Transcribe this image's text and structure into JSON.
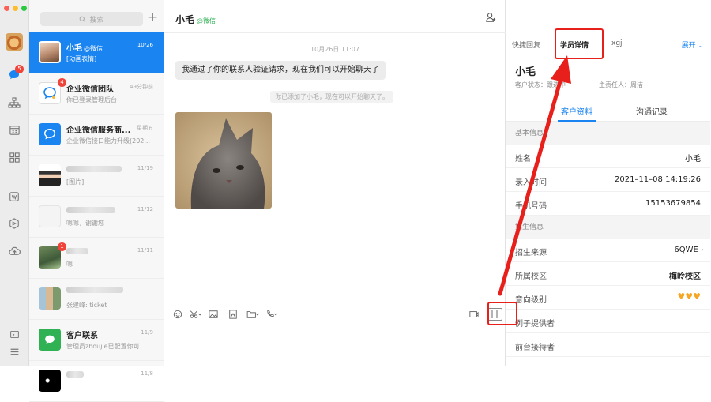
{
  "sidebar": {
    "badge": "5",
    "icons": [
      "avatar",
      "chat-icon",
      "org-icon",
      "calendar-icon",
      "apps-icon",
      "doc-icon",
      "drive-icon",
      "cloud-icon",
      "terminal-icon",
      "menu-icon"
    ]
  },
  "list": {
    "search_placeholder": "搜索",
    "items": [
      {
        "name": "小毛",
        "tag": "@微信",
        "time": "10/26",
        "preview": "[动画表情]"
      },
      {
        "name": "企业微信团队",
        "time": "49分钟前",
        "preview": "你已登录管理后台",
        "badge": "4"
      },
      {
        "name": "企业微信服务商...",
        "time": "星期五",
        "preview": "企业微信接口能力升级(202..."
      },
      {
        "name": "",
        "time": "11/19",
        "preview": "[图片]"
      },
      {
        "name": "",
        "time": "11/12",
        "preview": "嗯嗯，谢谢您"
      },
      {
        "name": "",
        "time": "11/11",
        "preview": "嗯",
        "badge": "1"
      },
      {
        "name": "",
        "time": "",
        "preview": "张建峰: ticket"
      },
      {
        "name": "客户联系",
        "time": "11/9",
        "preview": "管理员zhoujie已配置你可..."
      },
      {
        "name": "",
        "time": "11/8",
        "preview": ""
      }
    ]
  },
  "chat": {
    "title": "小毛",
    "tag": "@微信",
    "timestamp": "10月26日 11:07",
    "message": "我通过了你的联系人验证请求，现在我们可以开始聊天了",
    "system_message": "你已添加了小毛，现在可以开始聊天了。"
  },
  "panel": {
    "tabs": [
      "快捷回复",
      "学员详情",
      "xgj"
    ],
    "expand": "展开",
    "name": "小毛",
    "status_label": "客户状态：跟进中",
    "owner_label": "主责任人：周洁",
    "subtabs": [
      "客户资料",
      "沟通记录"
    ],
    "section_basic": "基本信息",
    "section_enroll": "招生信息",
    "rows_basic": [
      {
        "key": "姓名",
        "value": "小毛"
      },
      {
        "key": "录入时间",
        "value": "2021–11–08 14:19:26"
      },
      {
        "key": "手机号码",
        "value": "15153679854"
      }
    ],
    "rows_enroll": [
      {
        "key": "招生来源",
        "value": "6QWE"
      },
      {
        "key": "所属校区",
        "value": "梅岭校区"
      },
      {
        "key": "意向级别",
        "value": "♥♥♥"
      },
      {
        "key": "例子提供者",
        "value": ""
      },
      {
        "key": "前台接待者",
        "value": ""
      }
    ]
  },
  "colors": {
    "accent": "#1a84f0",
    "highlight": "#e8201c",
    "wechat_green": "#2fb154"
  }
}
